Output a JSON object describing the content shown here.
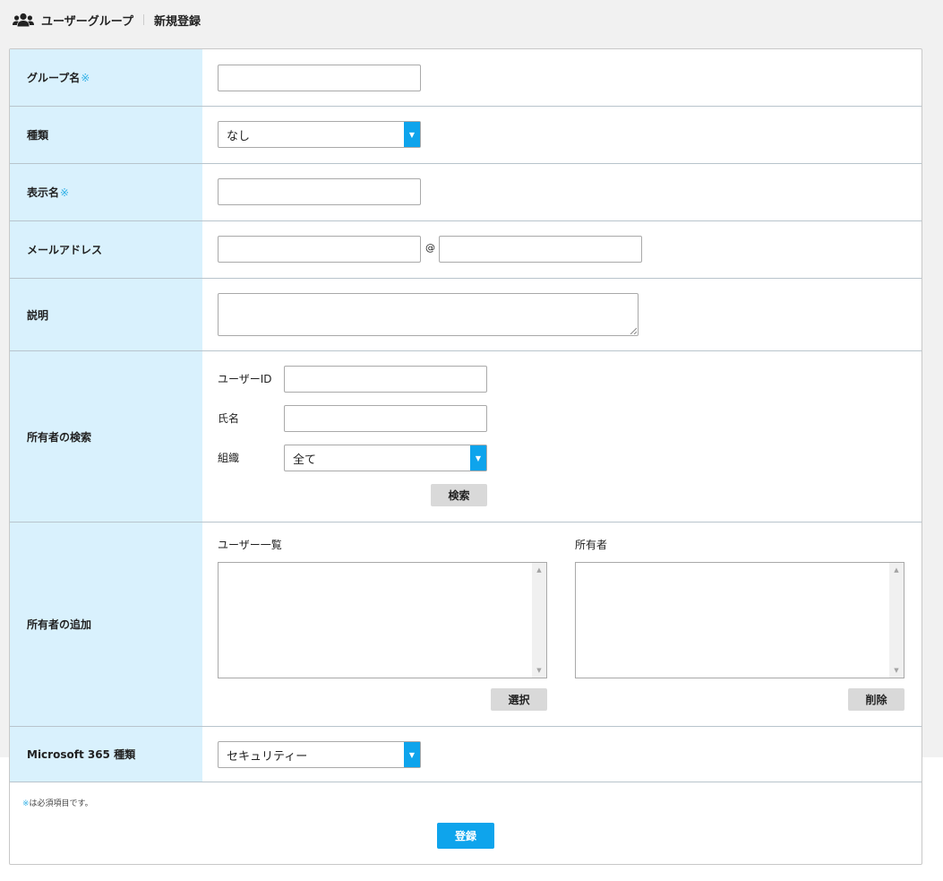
{
  "header": {
    "section": "ユーザーグループ",
    "page": "新規登録"
  },
  "form": {
    "required_mark": "※",
    "group_name": {
      "label": "グループ名",
      "value": ""
    },
    "type": {
      "label": "種類",
      "selected": "なし"
    },
    "display_name": {
      "label": "表示名",
      "value": ""
    },
    "email": {
      "label": "メールアドレス",
      "at": "@",
      "local": "",
      "domain": ""
    },
    "description": {
      "label": "説明",
      "value": ""
    },
    "owner_search": {
      "label": "所有者の検索",
      "user_id_label": "ユーザーID",
      "name_label": "氏名",
      "org_label": "組織",
      "org_selected": "全て",
      "search_button": "検索"
    },
    "owner_add": {
      "label": "所有者の追加",
      "user_list_label": "ユーザー一覧",
      "owner_list_label": "所有者",
      "select_button": "選択",
      "delete_button": "削除"
    },
    "m365_type": {
      "label": "Microsoft 365 種類",
      "selected": "セキュリティー"
    }
  },
  "footer": {
    "note_mark": "※",
    "note_text": "は必須項目です。",
    "submit_label": "登録"
  },
  "icons": {
    "header": "users-icon",
    "dropdown": "triangle-down",
    "scroll_up": "triangle-up",
    "scroll_down": "triangle-down"
  },
  "colors": {
    "accent": "#0ea4ec",
    "label_bg": "#d9f1fd",
    "required": "#33b1e6"
  }
}
